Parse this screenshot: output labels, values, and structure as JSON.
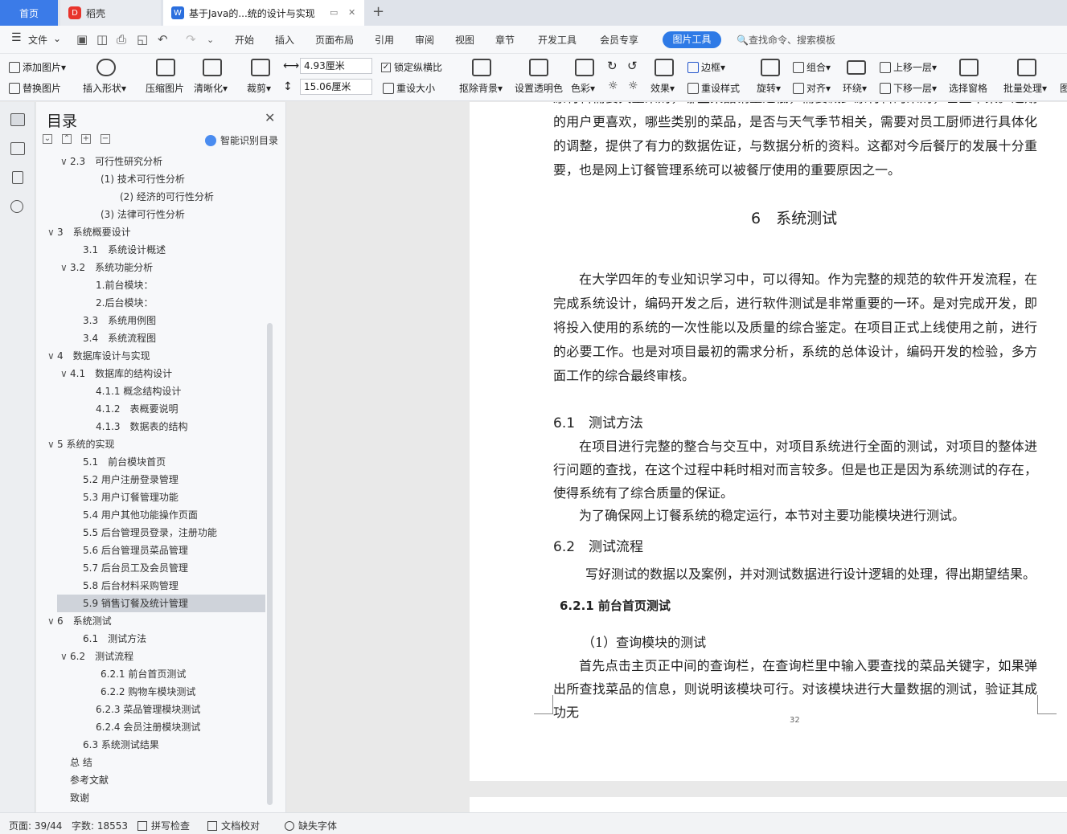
{
  "tabs": {
    "home": "首页",
    "daoke": "稻壳",
    "doc": "基于Java的...统的设计与实现"
  },
  "menu": {
    "file": "文件",
    "items": [
      "开始",
      "插入",
      "页面布局",
      "引用",
      "审阅",
      "视图",
      "章节",
      "开发工具",
      "会员专享"
    ],
    "picture_tools": "图片工具",
    "search": "查找命令、搜索模板"
  },
  "toolbar": {
    "add_image": "添加图片",
    "replace_image": "替换图片",
    "insert_shape": "插入形状",
    "compress": "压缩图片",
    "sharpen": "清晰化",
    "crop": "裁剪",
    "width": "4.93厘米",
    "height": "15.06厘米",
    "lock_ratio": "锁定纵横比",
    "lock_mark": "✓",
    "reset_size": "重设大小",
    "remove_bg": "抠除背景",
    "set_transparent": "设置透明色",
    "color": "色彩",
    "border": "边框",
    "effect": "效果",
    "reset_style": "重设样式",
    "rotate": "旋转",
    "group": "组合",
    "align": "对齐",
    "wrap": "环绕",
    "bring_forward": "上移一层",
    "send_backward": "下移一层",
    "select_pane": "选择窗格",
    "batch": "批量处理",
    "more": "图"
  },
  "toc": {
    "title": "目录",
    "smart": "智能识别目录",
    "items": [
      {
        "label": "2.3　可行性研究分析",
        "chev": "∨"
      },
      {
        "label": "(1) 技术可行性分析",
        "chev": ""
      },
      {
        "label": "(2) 经济的可行性分析",
        "chev": ""
      },
      {
        "label": "(3) 法律可行性分析",
        "chev": ""
      },
      {
        "label": "3　系统概要设计",
        "chev": "∨"
      },
      {
        "label": "3.1　系统设计概述",
        "chev": ""
      },
      {
        "label": "3.2　系统功能分析",
        "chev": "∨"
      },
      {
        "label": "1.前台模块：",
        "chev": ""
      },
      {
        "label": "2.后台模块：",
        "chev": ""
      },
      {
        "label": "3.3　系统用例图",
        "chev": ""
      },
      {
        "label": "3.4　系统流程图",
        "chev": ""
      },
      {
        "label": "4　数据库设计与实现",
        "chev": "∨"
      },
      {
        "label": "4.1　数据库的结构设计",
        "chev": "∨"
      },
      {
        "label": "4.1.1 概念结构设计",
        "chev": ""
      },
      {
        "label": "4.1.2　表概要说明",
        "chev": ""
      },
      {
        "label": "4.1.3　数据表的结构",
        "chev": ""
      },
      {
        "label": "5 系统的实现",
        "chev": "∨"
      },
      {
        "label": "5.1　前台模块首页",
        "chev": ""
      },
      {
        "label": "5.2 用户注册登录管理",
        "chev": ""
      },
      {
        "label": "5.3 用户订餐管理功能",
        "chev": ""
      },
      {
        "label": "5.4 用户其他功能操作页面",
        "chev": ""
      },
      {
        "label": "5.5 后台管理员登录，注册功能",
        "chev": ""
      },
      {
        "label": "5.6 后台管理员菜品管理",
        "chev": ""
      },
      {
        "label": "5.7 后台员工及会员管理",
        "chev": ""
      },
      {
        "label": "5.8 后台材料采购管理",
        "chev": ""
      },
      {
        "label": "5.9 销售订餐及统计管理",
        "chev": ""
      },
      {
        "label": "6　系统测试",
        "chev": "∨"
      },
      {
        "label": "6.1　测试方法",
        "chev": ""
      },
      {
        "label": "6.2　测试流程",
        "chev": "∨"
      },
      {
        "label": "6.2.1 前台首页测试",
        "chev": ""
      },
      {
        "label": "6.2.2 购物车模块测试",
        "chev": ""
      },
      {
        "label": "6.2.3 菜品管理模块测试",
        "chev": ""
      },
      {
        "label": "6.2.4 会员注册模块测试",
        "chev": ""
      },
      {
        "label": "6.3 系统测试结果",
        "chev": ""
      },
      {
        "label": "总 结",
        "chev": ""
      },
      {
        "label": "参考文献",
        "chev": ""
      },
      {
        "label": "致谢",
        "chev": ""
      }
    ]
  },
  "doc": {
    "p0": "原材料需要大量采购，哪些菜品销量过低，需要减少原材料的采购，甚至下架。近期的用户更喜欢，哪些类别的菜品，是否与天气季节相关，需要对员工厨师进行具体化的调整，提供了有力的数据佐证，与数据分析的资料。这都对今后餐厅的发展十分重要，也是网上订餐管理系统可以被餐厅使用的重要原因之一。",
    "h6": "6　系统测试",
    "p1": "在大学四年的专业知识学习中，可以得知。作为完整的规范的软件开发流程，在完成系统设计，编码开发之后，进行软件测试是非常重要的一环。是对完成开发，即将投入使用的系统的一次性能以及质量的综合鉴定。在项目正式上线使用之前，进行的必要工作。也是对项目最初的需求分析，系统的总体设计，编码开发的检验，多方面工作的综合最终审核。",
    "h61": "6.1　测试方法",
    "p2": "在项目进行完整的整合与交互中，对项目系统进行全面的测试，对项目的整体进行问题的查找，在这个过程中耗时相对而言较多。但是也正是因为系统测试的存在，使得系统有了综合质量的保证。",
    "p3": "为了确保网上订餐系统的稳定运行，本节对主要功能模块进行测试。",
    "h62": "6.2　测试流程",
    "p4": "写好测试的数据以及案例，并对测试数据进行设计逻辑的处理，得出期望结果。",
    "h621": "6.2.1 前台首页测试",
    "p5": "（1）查询模块的测试",
    "p6": "首先点击主页正中间的查询栏，在查询栏里中输入要查找的菜品关键字，如果弹出所查找菜品的信息，则说明该模块可行。对该模块进行大量数据的测试，验证其成功无",
    "page_num": "32"
  },
  "status": {
    "page": "页面: 39/44",
    "words": "字数: 18553",
    "spell": "拼写检查",
    "proof": "文档校对",
    "font": "缺失字体"
  }
}
